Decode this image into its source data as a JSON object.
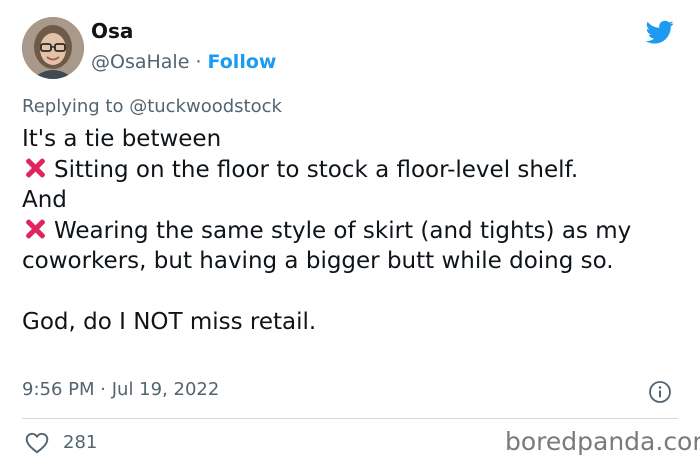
{
  "author": {
    "name": "Osa",
    "handle": "@OsaHale",
    "separator": "·",
    "follow_label": "Follow"
  },
  "reply": {
    "prefix": "Replying to",
    "mention": "@tuckwoodstock"
  },
  "tweet": {
    "line1": "It's a tie between",
    "item1": "Sitting on the floor to stock a floor-level shelf.",
    "line_and": "And",
    "item2": "Wearing the same style of skirt (and tights) as my coworkers, but having a bigger butt while doing so.",
    "closing": "God, do I NOT miss retail."
  },
  "meta": {
    "time": "9:56 PM",
    "separator": "·",
    "date": "Jul 19, 2022"
  },
  "stats": {
    "likes": "281"
  },
  "watermark": "boredpanda.com",
  "icons": {
    "brand": "twitter-bird-icon",
    "info": "info-icon",
    "like": "heart-icon",
    "bullet": "cross-mark-icon"
  },
  "colors": {
    "accent": "#1d9bf0",
    "text": "#0f1419",
    "secondary": "#536471",
    "cross": "#e0245e",
    "divider": "#cfd9de"
  }
}
